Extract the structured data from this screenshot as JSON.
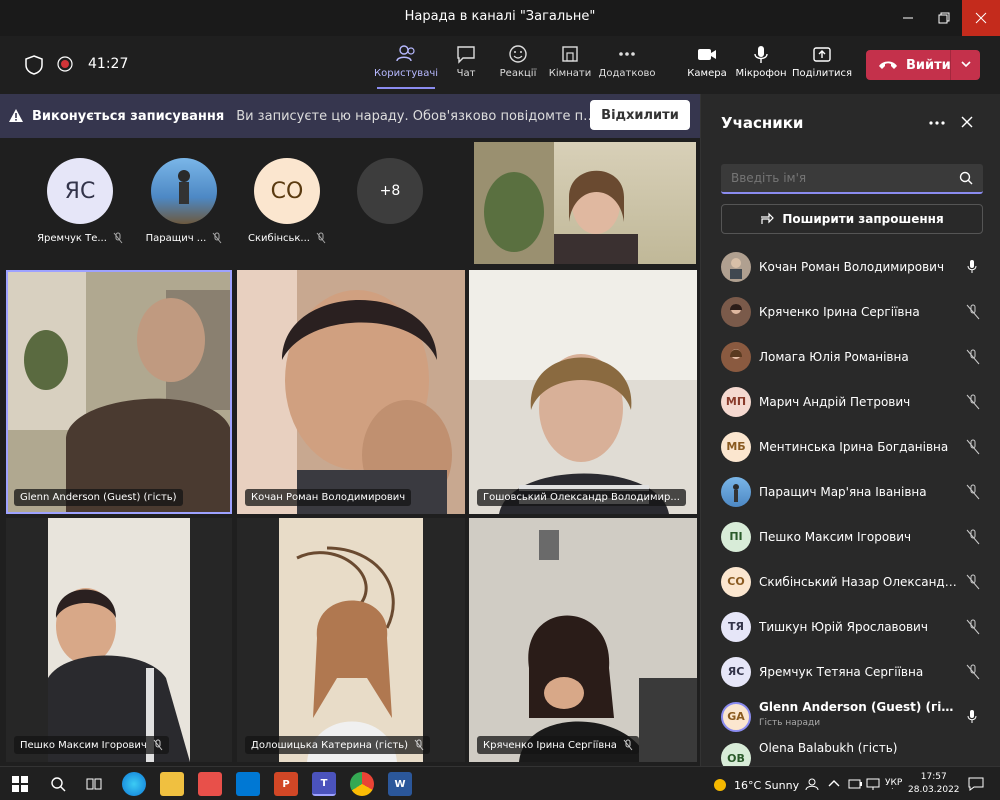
{
  "window": {
    "title": "Нарада в каналі \"Загальне\""
  },
  "toolbar": {
    "timer": "41:27",
    "items": [
      {
        "label": "Користувачі",
        "icon": "people-icon",
        "active": true
      },
      {
        "label": "Чат",
        "icon": "chat-icon"
      },
      {
        "label": "Реакції",
        "icon": "reactions-icon"
      },
      {
        "label": "Кімнати",
        "icon": "rooms-icon"
      },
      {
        "label": "Додатково",
        "icon": "more-icon"
      },
      {
        "label": "Камера",
        "icon": "camera-icon"
      },
      {
        "label": "Мікрофон",
        "icon": "microphone-icon"
      },
      {
        "label": "Поділитися",
        "icon": "share-icon"
      }
    ],
    "leave_label": "Вийти"
  },
  "banner": {
    "title": "Виконується записування",
    "message": "Ви записуєте цю нараду. Обов'язково повідомте про записування",
    "dismiss_label": "Відхилити"
  },
  "stage": {
    "avatars": [
      {
        "initials": "ЯС",
        "name": "Яремчук Те...",
        "bg": "#e6e6f8",
        "color": "#33344a"
      },
      {
        "initials": "",
        "name": "Паращич ...",
        "bg": "#5aa0d8",
        "color": "#fff"
      },
      {
        "initials": "СО",
        "name": "Скибінськ...",
        "bg": "#fbe6cf",
        "color": "#5a3a10"
      },
      {
        "initials": "+8",
        "name": "",
        "bg": "#3d3d3d",
        "color": "#fff"
      }
    ],
    "tiles": [
      {
        "name": "Glenn Anderson (Guest) (гість)"
      },
      {
        "name": "Кочан Роман Володимирович"
      },
      {
        "name": "Гошовський Олександр Володимир..."
      },
      {
        "name": "Пешко Максим Ігорович"
      },
      {
        "name": "Долошицька Катерина (гість)"
      },
      {
        "name": "Кряченко Ірина Сергіївна"
      }
    ]
  },
  "panel": {
    "title": "Учасники",
    "search_placeholder": "Введіть ім'я",
    "share_label": "Поширити запрошення",
    "participants": [
      {
        "name": "Кочан Роман Володимирович",
        "initials": "",
        "avatar_bg": "#b0a090",
        "mic": "on"
      },
      {
        "name": "Кряченко Ірина Сергіївна",
        "initials": "",
        "avatar_bg": "#7a5a4a",
        "mic": "off"
      },
      {
        "name": "Ломага Юлія Романівна",
        "initials": "",
        "avatar_bg": "#8a5a40",
        "mic": "off"
      },
      {
        "name": "Марич Андрій Петрович",
        "initials": "МП",
        "avatar_bg": "#f5d9d0",
        "mic": "off"
      },
      {
        "name": "Ментинська Ірина Богданівна",
        "initials": "МБ",
        "avatar_bg": "#fbe6cf",
        "mic": "off"
      },
      {
        "name": "Паращич Мар'яна Іванівна",
        "initials": "",
        "avatar_bg": "#5aa0d8",
        "mic": "off"
      },
      {
        "name": "Пешко Максим Ігорович",
        "initials": "ПІ",
        "avatar_bg": "#d8ecd8",
        "mic": "off"
      },
      {
        "name": "Скибінський Назар Олександр...",
        "initials": "СО",
        "avatar_bg": "#fbe6cf",
        "mic": "off"
      },
      {
        "name": "Тишкун Юрій Ярославович",
        "initials": "ТЯ",
        "avatar_bg": "#e6e6f8",
        "mic": "off"
      },
      {
        "name": "Яремчук Тетяна Сергіївна",
        "initials": "ЯС",
        "avatar_bg": "#e6e6f8",
        "mic": "off"
      },
      {
        "name": "Glenn Anderson (Guest) (гість)",
        "initials": "GA",
        "avatar_bg": "#fbe6cf",
        "mic": "on",
        "subtitle": "Гість наради",
        "bold": true
      },
      {
        "name": "Olena Balabukh (гість)",
        "initials": "OB",
        "avatar_bg": "#d8ecd8",
        "mic": "off"
      }
    ]
  },
  "taskbar": {
    "weather": "16°C  Sunny",
    "lang": "УКР",
    "time": "17:57",
    "date": "28.03.2022"
  }
}
